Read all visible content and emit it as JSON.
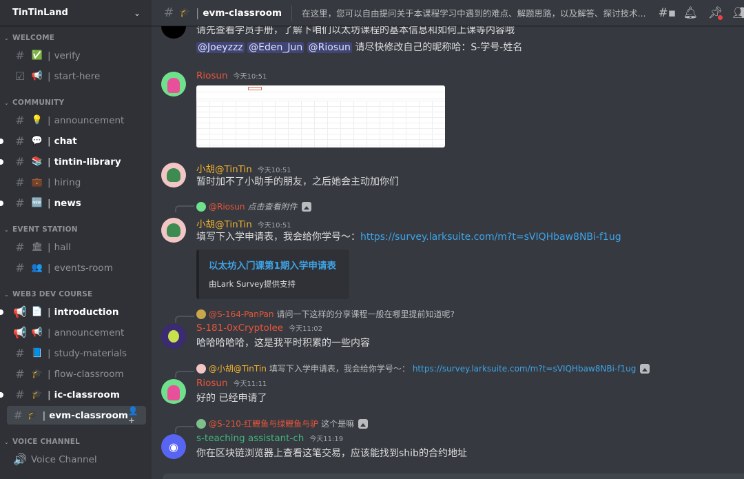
{
  "server": {
    "name": "TinTinLand",
    "chevron_icon": "chevron-down-icon"
  },
  "sidebar": {
    "categories": [
      {
        "name": "WELCOME",
        "channels": [
          {
            "icon": "#",
            "emoji": "✅",
            "name": "verify",
            "state": "normal"
          },
          {
            "icon": "☑",
            "emoji": "📢",
            "name": "start-here",
            "state": "normal"
          }
        ]
      },
      {
        "name": "COMMUNITY",
        "channels": [
          {
            "icon": "#",
            "emoji": "💡",
            "name": "announcement",
            "state": "normal"
          },
          {
            "icon": "#",
            "emoji": "💬",
            "name": "chat",
            "state": "unread"
          },
          {
            "icon": "#",
            "emoji": "📚",
            "name": "tintin-library",
            "state": "unread"
          },
          {
            "icon": "#",
            "emoji": "💼",
            "name": "hiring",
            "state": "normal"
          },
          {
            "icon": "#",
            "emoji": "🆕",
            "name": "news",
            "state": "unread"
          }
        ]
      },
      {
        "name": "EVENT STATION",
        "channels": [
          {
            "icon": "#",
            "emoji": "🏛",
            "name": "hall",
            "state": "normal"
          },
          {
            "icon": "#",
            "emoji": "👥",
            "name": "events-room",
            "state": "normal"
          }
        ]
      },
      {
        "name": "WEB3 DEV COURSE",
        "channels": [
          {
            "icon": "📢",
            "emoji": "📄",
            "name": "introduction",
            "state": "unread"
          },
          {
            "icon": "📢",
            "emoji": "📢",
            "name": "announcement",
            "state": "normal"
          },
          {
            "icon": "#",
            "emoji": "📘",
            "name": "study-materials",
            "state": "normal"
          },
          {
            "icon": "#",
            "emoji": "🎓",
            "name": "flow-classroom",
            "state": "normal"
          },
          {
            "icon": "#",
            "emoji": "🎓",
            "name": "ic-classroom",
            "state": "unread"
          },
          {
            "icon": "#",
            "emoji": "🎓",
            "name": "evm-classroom",
            "state": "active"
          }
        ]
      },
      {
        "name": "VOICE CHANNEL",
        "channels": [
          {
            "icon": "🔊",
            "emoji": "",
            "name": "Voice Channel",
            "state": "voice"
          }
        ]
      }
    ]
  },
  "topbar": {
    "channel_emoji": "🎓",
    "channel_name": "evm-classroom",
    "topic": "在这里，您可以自由提问关于本课程学习中遇到的难点、解题思路，以及解答、探讨技术...",
    "icons": [
      "threads-icon",
      "bell-icon",
      "pin-icon",
      "members-icon"
    ]
  },
  "messages": [
    {
      "id": "m0",
      "author": "",
      "timestamp": "",
      "lines": [
        "请先查看学员手册，了解下咱们以太坊课程的基本信息和如何上课等内容哦",
        ""
      ],
      "mentions": [
        "@Joeyzzz",
        "@Eden_Jun",
        "@Riosun"
      ],
      "after_mentions": " 请尽快修改自己的昵称哈：S-学号-姓名"
    },
    {
      "id": "m1",
      "author": "Riosun",
      "author_color": "#e8563b",
      "timestamp": "今天10:51",
      "attachment": "spreadsheet-screenshot"
    },
    {
      "id": "m2",
      "author": "小胡@TinTin",
      "author_color": "#f0b232",
      "timestamp": "今天10:51",
      "text": "暂时加不了小助手的朋友，之后她会主动加你们"
    },
    {
      "id": "m3",
      "reply": {
        "name": "@Riosun",
        "name_color": "#e8563b",
        "text": "点击查看附件",
        "italic": true
      },
      "author": "小胡@TinTin",
      "author_color": "#f0b232",
      "timestamp": "今天10:51",
      "text": "填写下入学申请表，我会给你学号～：",
      "link": "https://survey.larksuite.com/m?t=sVIQHbaw8NBi-f1ug",
      "embed": {
        "title": "以太坊入门课第1期入学申请表",
        "footer": "由Lark Survey提供支持"
      }
    },
    {
      "id": "m4",
      "reply": {
        "name": "@S-164-PanPan",
        "name_color": "#e8563b",
        "text": "请问一下这样的分享课程一般在哪里提前知道呢?"
      },
      "author": "S-181-0xCryptolee",
      "author_color": "#e8563b",
      "timestamp": "今天11:02",
      "text": "哈哈哈哈哈，这是我平时积累的一些内容"
    },
    {
      "id": "m5",
      "reply": {
        "name": "@小胡@TinTin",
        "name_color": "#f0b232",
        "text": "填写下入学申请表，我会给你学号～：",
        "link": "https://survey.larksuite.com/m?t=sVIQHbaw8NBi-f1ug"
      },
      "author": "Riosun",
      "author_color": "#e8563b",
      "timestamp": "今天11:11",
      "text": "好的 已经申请了"
    },
    {
      "id": "m6",
      "reply": {
        "name": "@S-210-红鲤鱼与绿鲤鱼与驴",
        "name_color": "#e8563b",
        "text": "这个是嘛"
      },
      "author": "s-teaching assistant-ch",
      "author_color": "#43b581",
      "timestamp": "今天11:19",
      "text": "你在区块链浏览器上查看这笔交易，应该能找到shib的合约地址"
    }
  ],
  "colors": {
    "accent": "#5865f2",
    "link": "#3ea4e8",
    "mention_bg": "#414675"
  }
}
